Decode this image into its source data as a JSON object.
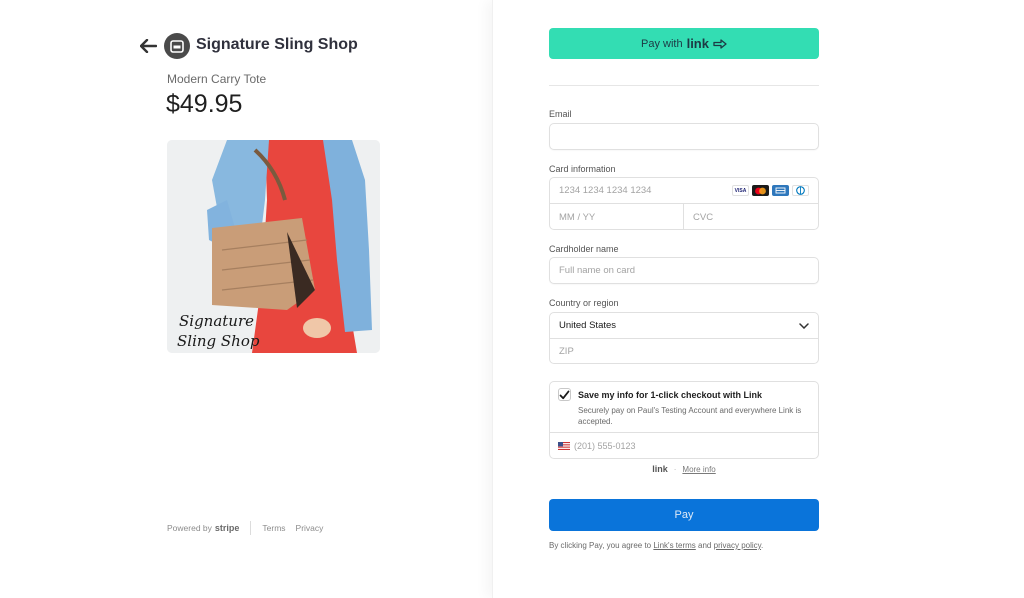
{
  "header": {
    "shop_name": "Signature Sling Shop",
    "product_name": "Modern Carry Tote",
    "price": "$49.95"
  },
  "product_image": {
    "watermark_line1": "Signature",
    "watermark_line2": "Sling Shop"
  },
  "footer": {
    "powered_by": "Powered by",
    "stripe": "stripe",
    "terms": "Terms",
    "privacy": "Privacy"
  },
  "express": {
    "pay_with": "Pay with",
    "link_word": "link",
    "color": "#33ddb3"
  },
  "form": {
    "email_label": "Email",
    "email_value": "",
    "card_label": "Card information",
    "card_number_placeholder": "1234 1234 1234 1234",
    "expiry_placeholder": "MM / YY",
    "cvc_placeholder": "CVC",
    "card_brands": [
      "VISA",
      "mastercard",
      "amex",
      "diners"
    ],
    "cardholder_label": "Cardholder name",
    "cardholder_placeholder": "Full name on card",
    "country_label": "Country or region",
    "country_value": "United States",
    "zip_placeholder": "ZIP"
  },
  "link_save": {
    "checked": true,
    "title": "Save my info for 1-click checkout with Link",
    "description": "Securely pay on Paul's Testing Account and everywhere Link is accepted.",
    "phone_placeholder": "(201) 555-0123",
    "footer_link": "link",
    "footer_dot": "·",
    "more_info": "More info"
  },
  "pay": {
    "label": "Pay",
    "color": "#0a74da",
    "terms_prefix": "By clicking Pay, you agree to",
    "links_terms": "Link's terms",
    "and": "and",
    "privacy_policy": "privacy policy",
    "period": "."
  }
}
